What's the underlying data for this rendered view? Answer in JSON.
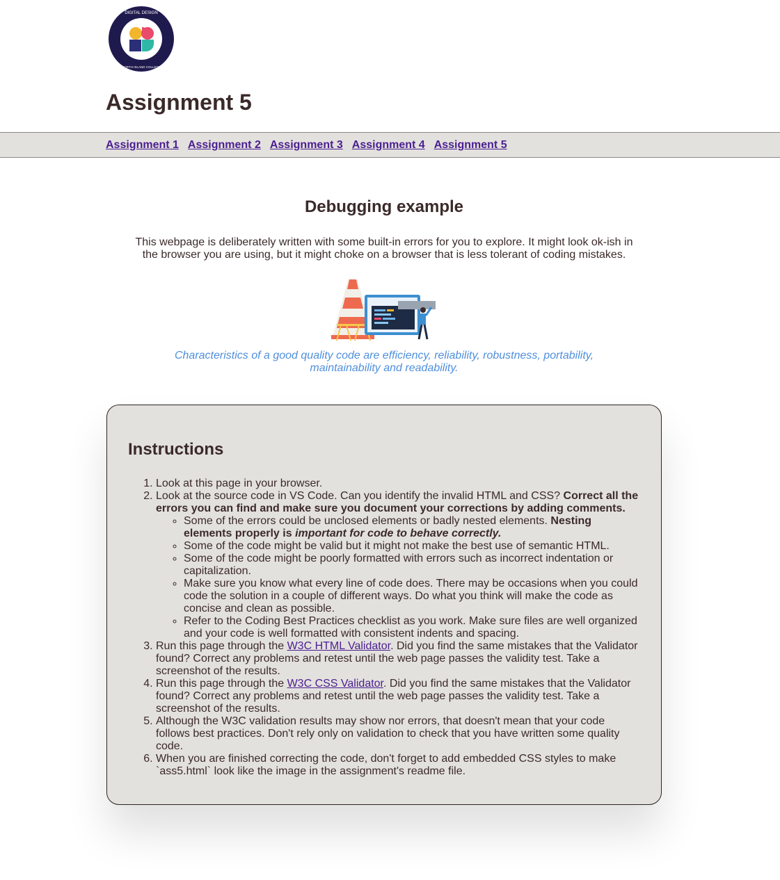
{
  "header": {
    "logo_text": "DIGITAL DESIGN + DEVELOPMENT · NORTH ISLAND COLLEGE",
    "title": "Assignment 5"
  },
  "nav": {
    "links": [
      {
        "label": "Assignment 1"
      },
      {
        "label": "Assignment 2"
      },
      {
        "label": "Assignment 3"
      },
      {
        "label": "Assignment 4"
      },
      {
        "label": "Assignment 5"
      }
    ]
  },
  "intro": {
    "heading": "Debugging example",
    "lead": "This webpage is deliberately written with some built-in errors for you to explore. It might look ok-ish in the browser you are using, but it might choke on a browser that is less tolerant of coding mistakes.",
    "caption": "Characteristics of a good quality code are efficiency, reliability, robustness, portability, maintainability and readability."
  },
  "instructions": {
    "heading": "Instructions",
    "step1": "Look at this page in your browser.",
    "step2_text": "Look at the source code in VS Code. Can you identify the invalid HTML and CSS? ",
    "step2_bold": "Correct all the errors you can find and make sure you document your corrections by adding comments.",
    "sub1_text": "Some of the errors could be unclosed elements or badly nested elements. ",
    "sub1_bold": "Nesting elements properly is ",
    "sub1_bold_italic": "important for code to behave correctly.",
    "sub2": "Some of the code might be valid but it might not make the best use of semantic HTML.",
    "sub3": "Some of the code might be poorly formatted with errors such as incorrect indentation or capitalization.",
    "sub4": "Make sure you know what every line of code does. There may be occasions when you could code the solution in a couple of different ways. Do what you think will make the code as concise and clean as possible.",
    "sub5": "Refer to the Coding Best Practices checklist as you work. Make sure files are well organized and your code is well formatted with consistent indents and spacing.",
    "step3_pre": "Run this page through the ",
    "step3_link": "W3C HTML Validator",
    "step3_post": ". Did you find the same mistakes that the Validator found? Correct any problems and retest until the web page passes the validity test. Take a screenshot of the results.",
    "step4_pre": "Run this page through the ",
    "step4_link": "W3C CSS Validator",
    "step4_post": ". Did you find the same mistakes that the Validator found? Correct any problems and retest until the web page passes the validity test. Take a screenshot of the results.",
    "step5": "Although the W3C validation results may show nor errors, that doesn't mean that your code follows best practices. Don't rely only on validation to check that you have written some quality code.",
    "step6": "When you are finished correcting the code, don't forget to add embedded CSS styles to make `ass5.html` look like the image in the assignment's readme file."
  },
  "colors": {
    "text": "#3b2a2a",
    "link": "#4b1e91",
    "caption": "#4f8fdc",
    "panel_bg": "#e3e1de"
  }
}
